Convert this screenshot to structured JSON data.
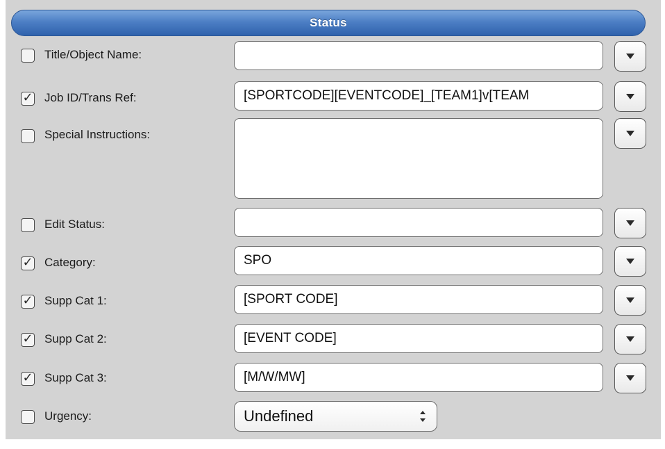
{
  "header": {
    "title": "Status"
  },
  "rows": [
    {
      "label": "Title/Object Name:",
      "checked": false,
      "value": ""
    },
    {
      "label": "Job ID/Trans Ref:",
      "checked": true,
      "value": "[SPORTCODE][EVENTCODE]_[TEAM1]v[TEAM"
    },
    {
      "label": "Special Instructions:",
      "checked": false,
      "value": ""
    },
    {
      "label": "Edit Status:",
      "checked": false,
      "value": ""
    },
    {
      "label": "Category:",
      "checked": true,
      "value": "SPO"
    },
    {
      "label": "Supp Cat 1:",
      "checked": true,
      "value": "[SPORT CODE]"
    },
    {
      "label": "Supp Cat 2:",
      "checked": true,
      "value": "[EVENT CODE]"
    },
    {
      "label": "Supp Cat 3:",
      "checked": true,
      "value": "[M/W/MW]"
    },
    {
      "label": "Urgency:",
      "checked": false,
      "value": "Undefined"
    }
  ],
  "icons": {
    "checkbox_checked": "check-mark",
    "dropdown": "triangle-down",
    "select": "up-down-arrows"
  },
  "colors": {
    "header_blue": "#4d7fc5",
    "panel_background": "#d3d3d3"
  }
}
